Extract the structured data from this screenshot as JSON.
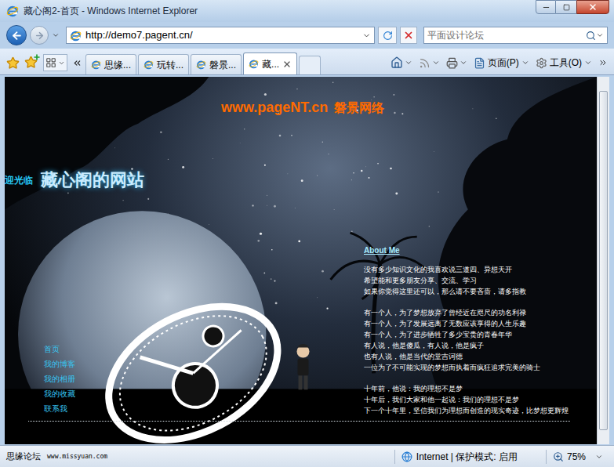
{
  "window": {
    "title": "藏心阁2-首页 - Windows Internet Explorer"
  },
  "address_bar": {
    "url": "http://demo7.pagent.cn/"
  },
  "search": {
    "placeholder": "平面设计论坛"
  },
  "tabs": [
    {
      "label": "思缘...",
      "selected": false
    },
    {
      "label": "玩转...",
      "selected": false
    },
    {
      "label": "磐景...",
      "selected": false
    },
    {
      "label": "藏...",
      "selected": true
    }
  ],
  "toolbar": {
    "buttons": [
      {
        "label": "页面(P)"
      },
      {
        "label": "工具(O)"
      }
    ]
  },
  "page": {
    "logo": {
      "domain": "www.pageNT.cn",
      "name": "磐景网络"
    },
    "welcome": "迎光临",
    "site_title": "藏心阁的网站",
    "about": {
      "heading": "About Me",
      "paragraphs": [
        [
          "没有多少知识文化的我喜欢说三道四、异想天开",
          "希望能和更多朋友分享、交流、学习",
          "如果你觉得这里还可以，那么请不要吝啬，请多指教"
        ],
        [
          "有一个人，为了梦想放弃了曾经近在咫尺的功名利禄",
          "有一个人，为了发展远离了无数应该享得的人生乐趣",
          "有一个人，为了进步牺牲了多少宝贵的青春年华",
          "有人说，他是傻瓜，有人说，他是疯子",
          "也有人说，他是当代的堂吉诃德",
          "一位为了不可能实现的梦想而执着而疯狂追求完美的骑士"
        ],
        [
          "十年前，他说：我的理想不是梦",
          "十年后，我们大家和他一起说：我们的理想不是梦",
          "下一个十年里，坚信我们为理想而创造的现实奇迹，比梦想更辉煌"
        ]
      ]
    },
    "nav": [
      {
        "label": "首页"
      },
      {
        "label": "我的博客"
      },
      {
        "label": "我的相册"
      },
      {
        "label": "我的收藏"
      },
      {
        "label": "联系我"
      }
    ]
  },
  "status_bar": {
    "watermark": "思缘论坛",
    "watermark_url": "www.missyuan.com",
    "zone": "Internet | 保护模式: 启用",
    "zoom": "75%"
  }
}
